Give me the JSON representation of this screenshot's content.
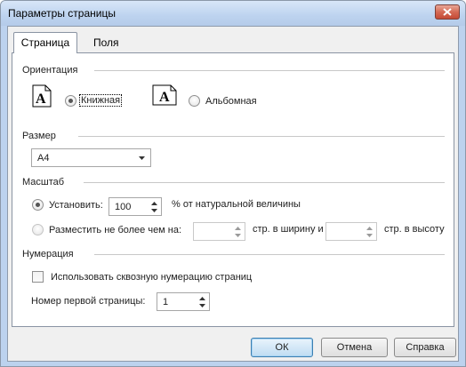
{
  "window": {
    "title": "Параметры страницы"
  },
  "tabs": [
    {
      "label": "Страница"
    },
    {
      "label": "Поля"
    }
  ],
  "orientation": {
    "heading": "Ориентация",
    "portrait": {
      "label": "Книжная",
      "selected": true
    },
    "landscape": {
      "label": "Альбомная",
      "selected": false
    }
  },
  "size": {
    "heading": "Размер",
    "selected": "A4"
  },
  "scale": {
    "heading": "Масштаб",
    "adjust": {
      "label": "Установить:",
      "value": "100",
      "suffix": "% от натуральной величины",
      "selected": true
    },
    "fit": {
      "label": "Разместить не более чем на:",
      "wide_value": "",
      "wide_suffix": "стр. в ширину и",
      "tall_value": "",
      "tall_suffix": "стр. в высоту",
      "selected": false
    }
  },
  "numbering": {
    "heading": "Нумерация",
    "continuous_label": "Использовать сквозную нумерацию страниц",
    "continuous_checked": false,
    "first_page_label": "Номер первой страницы:",
    "first_page_value": "1"
  },
  "buttons": {
    "ok": "ОК",
    "cancel": "Отмена",
    "help": "Справка"
  }
}
